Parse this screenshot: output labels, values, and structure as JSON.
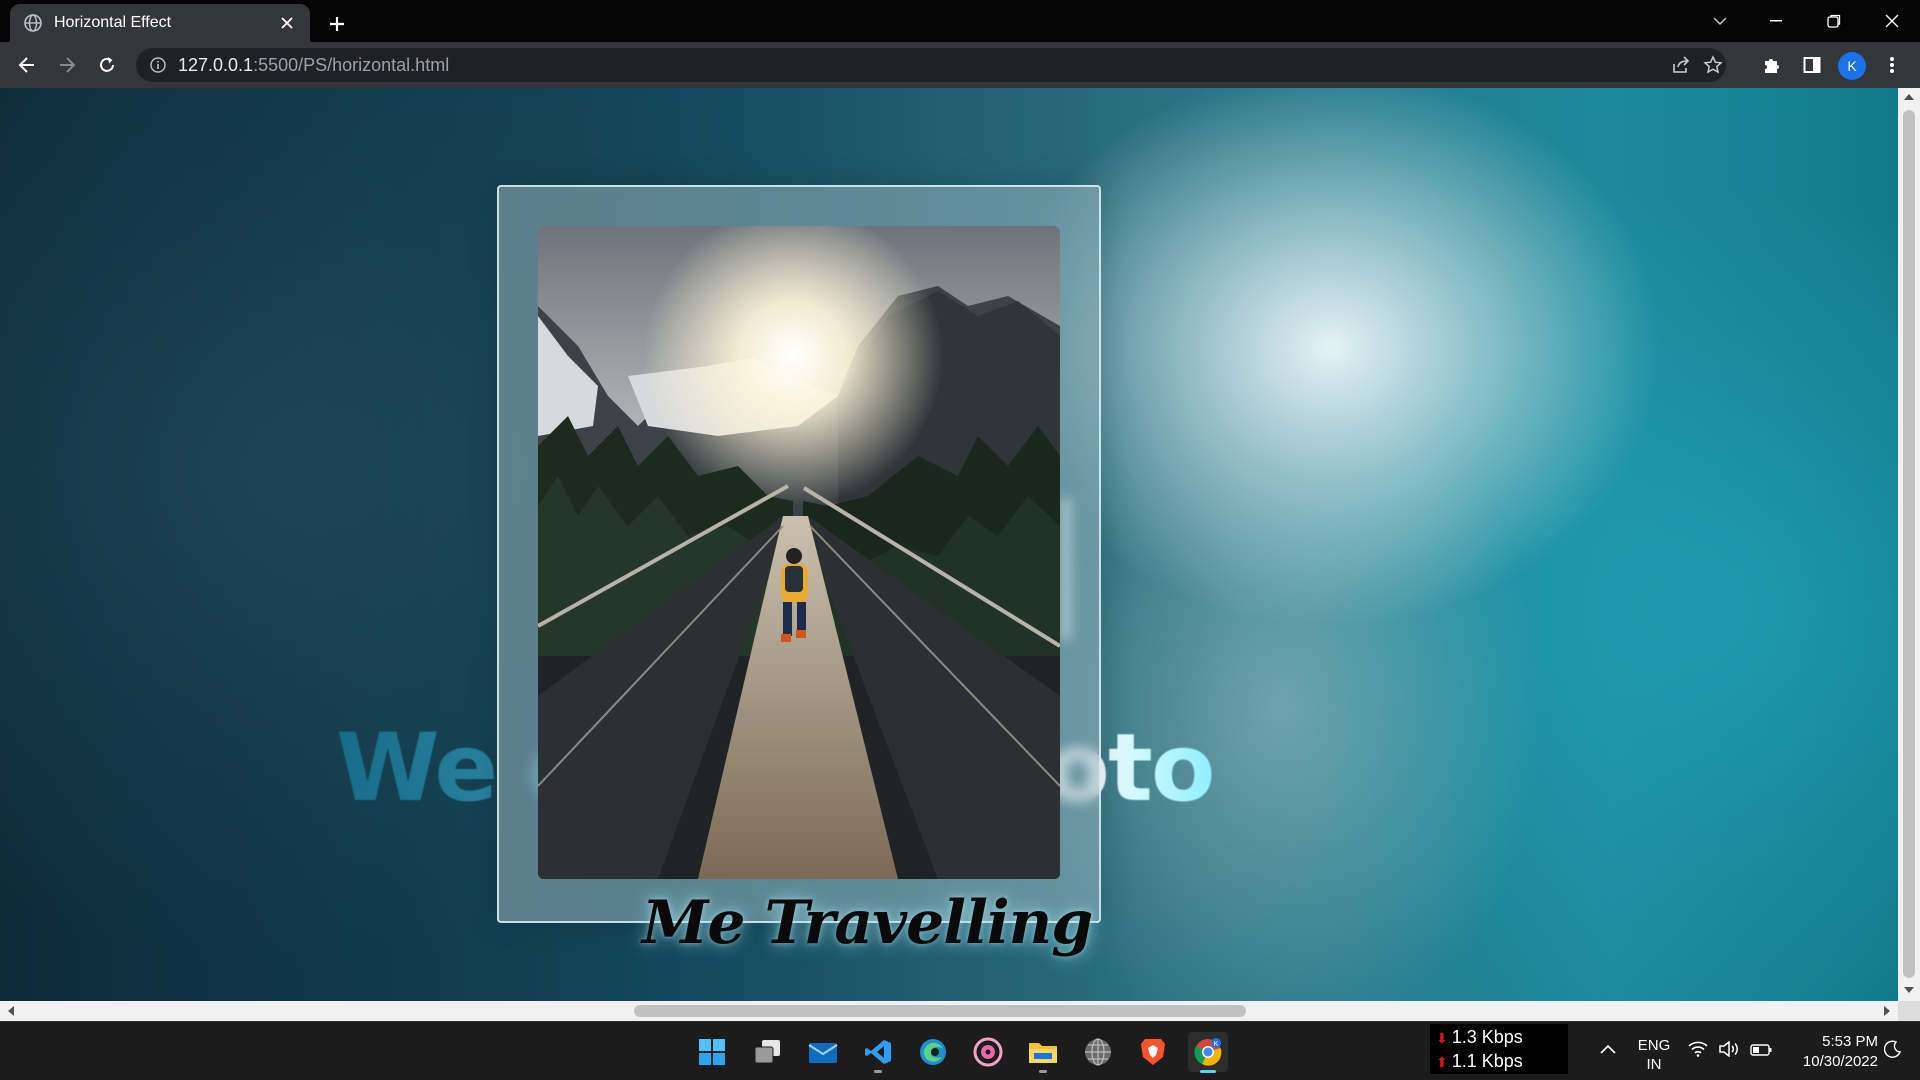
{
  "browser": {
    "tab_title": "Horizontal Effect",
    "url_host": "127.0.0.1",
    "url_rest": ":5500/PS/horizontal.html",
    "profile_initial": "K"
  },
  "page": {
    "background_text": "We c      l that photo",
    "caption": "Me Travelling"
  },
  "taskbar": {
    "net_down": "1.3 Kbps",
    "net_up": "1.1 Kbps",
    "lang_top": "ENG",
    "lang_bottom": "IN",
    "time": "5:53 PM",
    "date": "10/30/2022",
    "apps": [
      "start-icon",
      "task-view-icon",
      "mail-icon",
      "vscode-icon",
      "edge-icon",
      "media-player-icon",
      "file-explorer-icon",
      "globe-icon",
      "brave-icon",
      "chrome-icon"
    ]
  },
  "colors": {
    "chrome_dark": "#35363a",
    "titlebar": "#050505",
    "taskbar": "#1c1c1c",
    "accent_blue": "#1a73e8"
  }
}
